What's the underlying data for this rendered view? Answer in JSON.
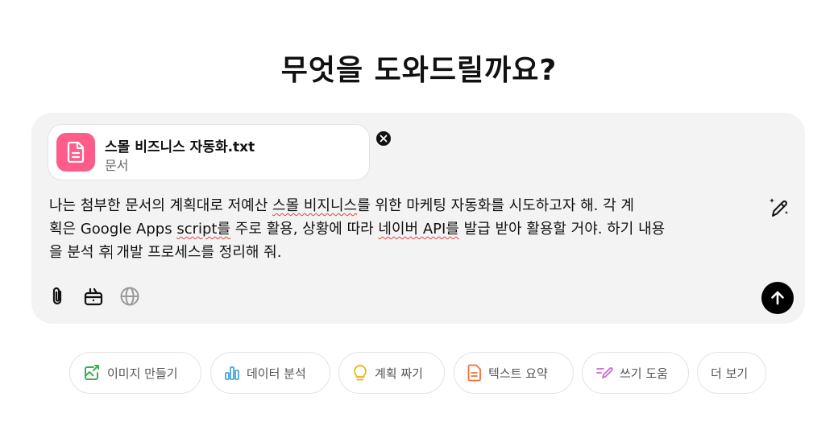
{
  "heading": "무엇을 도와드릴까요?",
  "attachment": {
    "name": "스몰 비즈니스 자동화.txt",
    "type": "문서",
    "icon": "document-icon",
    "color": "#ff5c8a"
  },
  "prompt": {
    "line1_a": "나는 첨부한 문서의 계획대로 저예산 ",
    "line1_b": "스몰 비지니스",
    "line1_c": "를 위한 마케팅 자동화를 시도하고자 해. 각 계",
    "line2_a": "획은 Google Apps ",
    "line2_b": "script를",
    "line2_c": " 주로 활용, 상황에 따라 ",
    "line2_d": "네이버 API를",
    "line2_e": " 발급 받아 활용할 거야. 하기 내용",
    "line3_a": "을 분석 후",
    "line3_b": " 개발 프로세스를 정리해 줘."
  },
  "toolbar": {
    "attach_icon": "paperclip-icon",
    "tools_icon": "toolbox-icon",
    "web_icon": "globe-icon",
    "send_icon": "arrow-up-icon",
    "enhance_icon": "magic-pen-icon"
  },
  "suggestions": [
    {
      "label": "이미지 만들기",
      "icon": "image-icon",
      "color": "#3cae5a"
    },
    {
      "label": "데이터 분석",
      "icon": "bar-chart-icon",
      "color": "#4aa8d8"
    },
    {
      "label": "계획 짜기",
      "icon": "lightbulb-icon",
      "color": "#e8b923"
    },
    {
      "label": "텍스트 요약",
      "icon": "document-icon",
      "color": "#f0703a"
    },
    {
      "label": "쓰기 도움",
      "icon": "pen-icon",
      "color": "#c86bd0"
    },
    {
      "label": "더 보기",
      "icon": "",
      "color": ""
    }
  ]
}
